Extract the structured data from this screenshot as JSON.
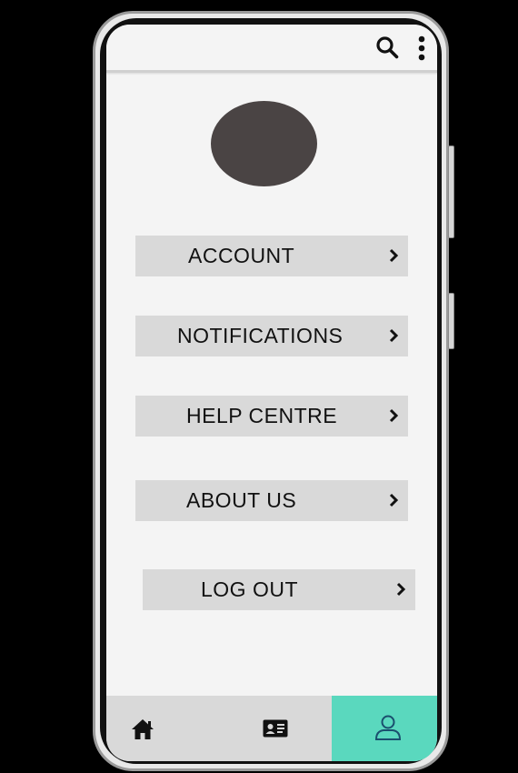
{
  "colors": {
    "screen_background": "#f4f4f4",
    "menu_item_background": "#d9d9d9",
    "avatar": "#4a4444",
    "active_tab": "#5ad8be",
    "text": "#111111"
  },
  "topbar": {
    "icons": [
      "search-icon",
      "more-vertical-icon"
    ]
  },
  "profile": {
    "avatar_icon": "avatar"
  },
  "menu": {
    "items": [
      {
        "label": "ACCOUNT",
        "icon": "chevron-right-icon"
      },
      {
        "label": "NOTIFICATIONS",
        "icon": "chevron-right-icon"
      },
      {
        "label": "HELP CENTRE",
        "icon": "chevron-right-icon"
      },
      {
        "label": "ABOUT US",
        "icon": "chevron-right-icon"
      },
      {
        "label": "LOG OUT",
        "icon": "chevron-right-icon"
      }
    ]
  },
  "bottom_nav": {
    "tabs": [
      {
        "icon": "home-icon",
        "active": false
      },
      {
        "icon": "contact-card-icon",
        "active": false
      },
      {
        "icon": "user-profile-icon",
        "active": true
      }
    ]
  }
}
